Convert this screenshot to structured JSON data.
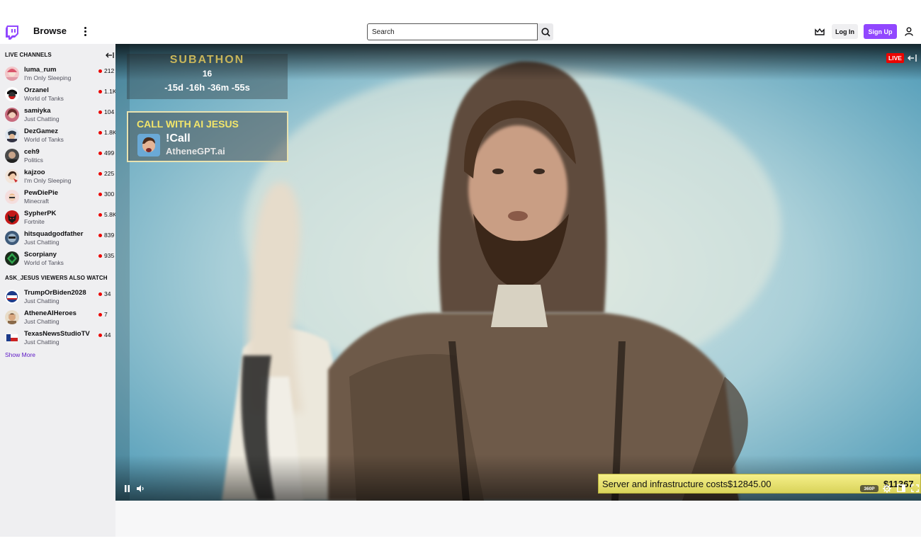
{
  "nav": {
    "browse_label": "Browse",
    "search_placeholder": "Search",
    "login_label": "Log In",
    "signup_label": "Sign Up",
    "icons": [
      "twitch-logo-icon",
      "kebab-menu-icon",
      "search-icon",
      "crown-icon",
      "user-icon"
    ],
    "colors": {
      "brand": "#9147ff"
    }
  },
  "sidebar": {
    "live_header": "LIVE CHANNELS",
    "also_watch_header": "ASK_JESUS VIEWERS ALSO WATCH",
    "show_more": "Show More",
    "live_channels": [
      {
        "name": "luma_rum",
        "game": "I'm Only Sleeping",
        "viewers": "212"
      },
      {
        "name": "Orzanel",
        "game": "World of Tanks",
        "viewers": "1.1K"
      },
      {
        "name": "samiyka",
        "game": "Just Chatting",
        "viewers": "104"
      },
      {
        "name": "DezGamez",
        "game": "World of Tanks",
        "viewers": "1.8K"
      },
      {
        "name": "ceh9",
        "game": "Politics",
        "viewers": "499"
      },
      {
        "name": "kajzoo",
        "game": "I'm Only Sleeping",
        "viewers": "225"
      },
      {
        "name": "PewDiePie",
        "game": "Minecraft",
        "viewers": "300"
      },
      {
        "name": "SypherPK",
        "game": "Fortnite",
        "viewers": "5.8K"
      },
      {
        "name": "hitsquadgodfather",
        "game": "Just Chatting",
        "viewers": "839"
      },
      {
        "name": "Scorpiany",
        "game": "World of Tanks",
        "viewers": "935"
      }
    ],
    "also_watch": [
      {
        "name": "TrumpOrBiden2028",
        "game": "Just Chatting",
        "viewers": "34"
      },
      {
        "name": "AtheneAIHeroes",
        "game": "Just Chatting",
        "viewers": "7"
      },
      {
        "name": "TexasNewsStudioTV",
        "game": "Just Chatting",
        "viewers": "44"
      }
    ]
  },
  "player": {
    "subathon": {
      "title": "SUBATHON",
      "count": "16",
      "timer": "-15d -16h -36m -55s"
    },
    "call": {
      "title": "CALL WITH AI JESUS",
      "command": "!Call",
      "site": "AtheneGPT.ai"
    },
    "live_badge": "LIVE",
    "costs_text": "Server and infrastructure costs$12845.00",
    "costs_amount": "$11367",
    "quality": "360P"
  }
}
